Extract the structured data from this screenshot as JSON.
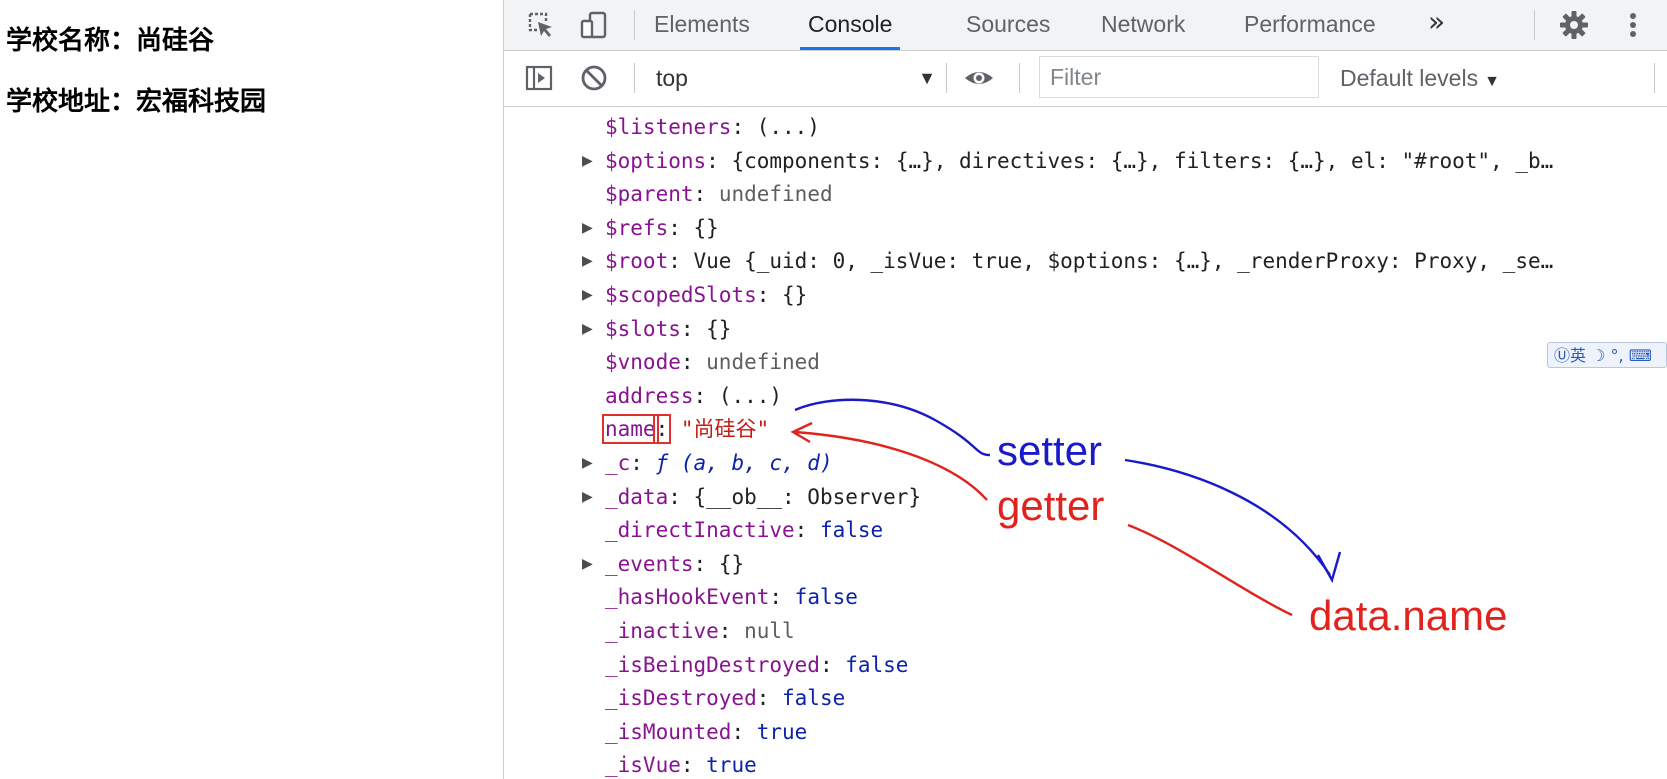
{
  "page": {
    "school_name": "学校名称：尚硅谷",
    "school_address": "学校地址：宏福科技园"
  },
  "devtools": {
    "tabs": [
      {
        "label": "Elements"
      },
      {
        "label": "Console"
      },
      {
        "label": "Sources"
      },
      {
        "label": "Network"
      },
      {
        "label": "Performance"
      }
    ],
    "active_tab": "Console",
    "more_tabs_label": "»",
    "toolbar": {
      "context": "top",
      "filter_placeholder": "Filter",
      "levels": "Default levels"
    },
    "icons": {
      "inspect": "inspect-element-icon",
      "device": "device-toolbar-icon",
      "settings": "gear-icon",
      "menu": "kebab-menu-icon",
      "sidebar": "show-sidebar-icon",
      "clear": "clear-console-icon",
      "eye": "eye-icon"
    }
  },
  "console": {
    "rows": [
      {
        "expandable": false,
        "key": "$listeners",
        "value": "(...)"
      },
      {
        "expandable": true,
        "key": "$options",
        "value": "{components: {…}, directives: {…}, filters: {…}, el: \"#root\", _b…"
      },
      {
        "expandable": false,
        "key": "$parent",
        "value": "undefined"
      },
      {
        "expandable": true,
        "key": "$refs",
        "value": "{}"
      },
      {
        "expandable": true,
        "key": "$root",
        "value": "Vue {_uid: 0, _isVue: true, $options: {…}, _renderProxy: Proxy, _se…"
      },
      {
        "expandable": true,
        "key": "$scopedSlots",
        "value": "{}"
      },
      {
        "expandable": true,
        "key": "$slots",
        "value": "{}"
      },
      {
        "expandable": false,
        "key": "$vnode",
        "value": "undefined"
      },
      {
        "expandable": false,
        "key": "address",
        "value": "(...)"
      },
      {
        "expandable": false,
        "key": "name",
        "value": "\"尚硅谷\""
      },
      {
        "expandable": true,
        "key": "_c",
        "value": "ƒ (a, b, c, d)"
      },
      {
        "expandable": true,
        "key": "_data",
        "value": "{__ob__: Observer}"
      },
      {
        "expandable": false,
        "key": "_directInactive",
        "value": "false"
      },
      {
        "expandable": true,
        "key": "_events",
        "value": "{}"
      },
      {
        "expandable": false,
        "key": "_hasHookEvent",
        "value": "false"
      },
      {
        "expandable": false,
        "key": "_inactive",
        "value": "null"
      },
      {
        "expandable": false,
        "key": "_isBeingDestroyed",
        "value": "false"
      },
      {
        "expandable": false,
        "key": "_isDestroyed",
        "value": "false"
      },
      {
        "expandable": false,
        "key": "_isMounted",
        "value": "true"
      },
      {
        "expandable": false,
        "key": "_isVue",
        "value": "true"
      }
    ]
  },
  "ime_badge": "Ⓤ英 ☽ °, ⌨",
  "annotations": {
    "setter": "setter",
    "getter": "getter",
    "data_name": "data.name",
    "colors": {
      "blue": "#1a1ac8",
      "red": "#e0231c"
    }
  }
}
